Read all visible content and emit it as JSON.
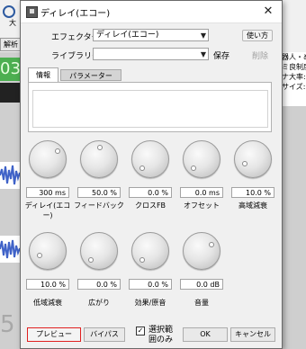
{
  "background": {
    "zoom_label": "大",
    "tab_label": "解析",
    "green_text": "03",
    "right_panel_lines": [
      "器人・め",
      "ミ良制度",
      "ナ大率: 1",
      "サイズ: 00"
    ],
    "bottom_number": "5"
  },
  "dialog": {
    "title": "ディレイ(エコー)",
    "close_label": "✕",
    "effector_label": "エフェクター",
    "effector_value": "ディレイ(エコー)",
    "usage_button": "使い方",
    "library_label": "ライブラリー",
    "library_value": "",
    "save_label": "保存",
    "delete_label": "削除",
    "tabs": [
      {
        "label": "情報",
        "active": true
      },
      {
        "label": "パラメーター",
        "active": false
      }
    ],
    "knobs": [
      {
        "value": "300 ms",
        "label": "ディレイ(エコー)"
      },
      {
        "value": "50.0 %",
        "label": "フィードバック"
      },
      {
        "value": "0.0 %",
        "label": "クロスFB"
      },
      {
        "value": "0.0 ms",
        "label": "オフセット"
      },
      {
        "value": "10.0 %",
        "label": "高域減衰"
      },
      {
        "value": "10.0 %",
        "label": "低域減衰"
      },
      {
        "value": "0.0 %",
        "label": "広がり"
      },
      {
        "value": "0.0 %",
        "label": "効果/原音"
      },
      {
        "value": "0.0 dB",
        "label": "音量"
      }
    ],
    "buttons": {
      "preview": "プレビュー",
      "bypass": "バイパス",
      "selection_only": "選択範囲のみ",
      "selection_checked": true,
      "ok": "OK",
      "cancel": "キャンセル"
    }
  }
}
